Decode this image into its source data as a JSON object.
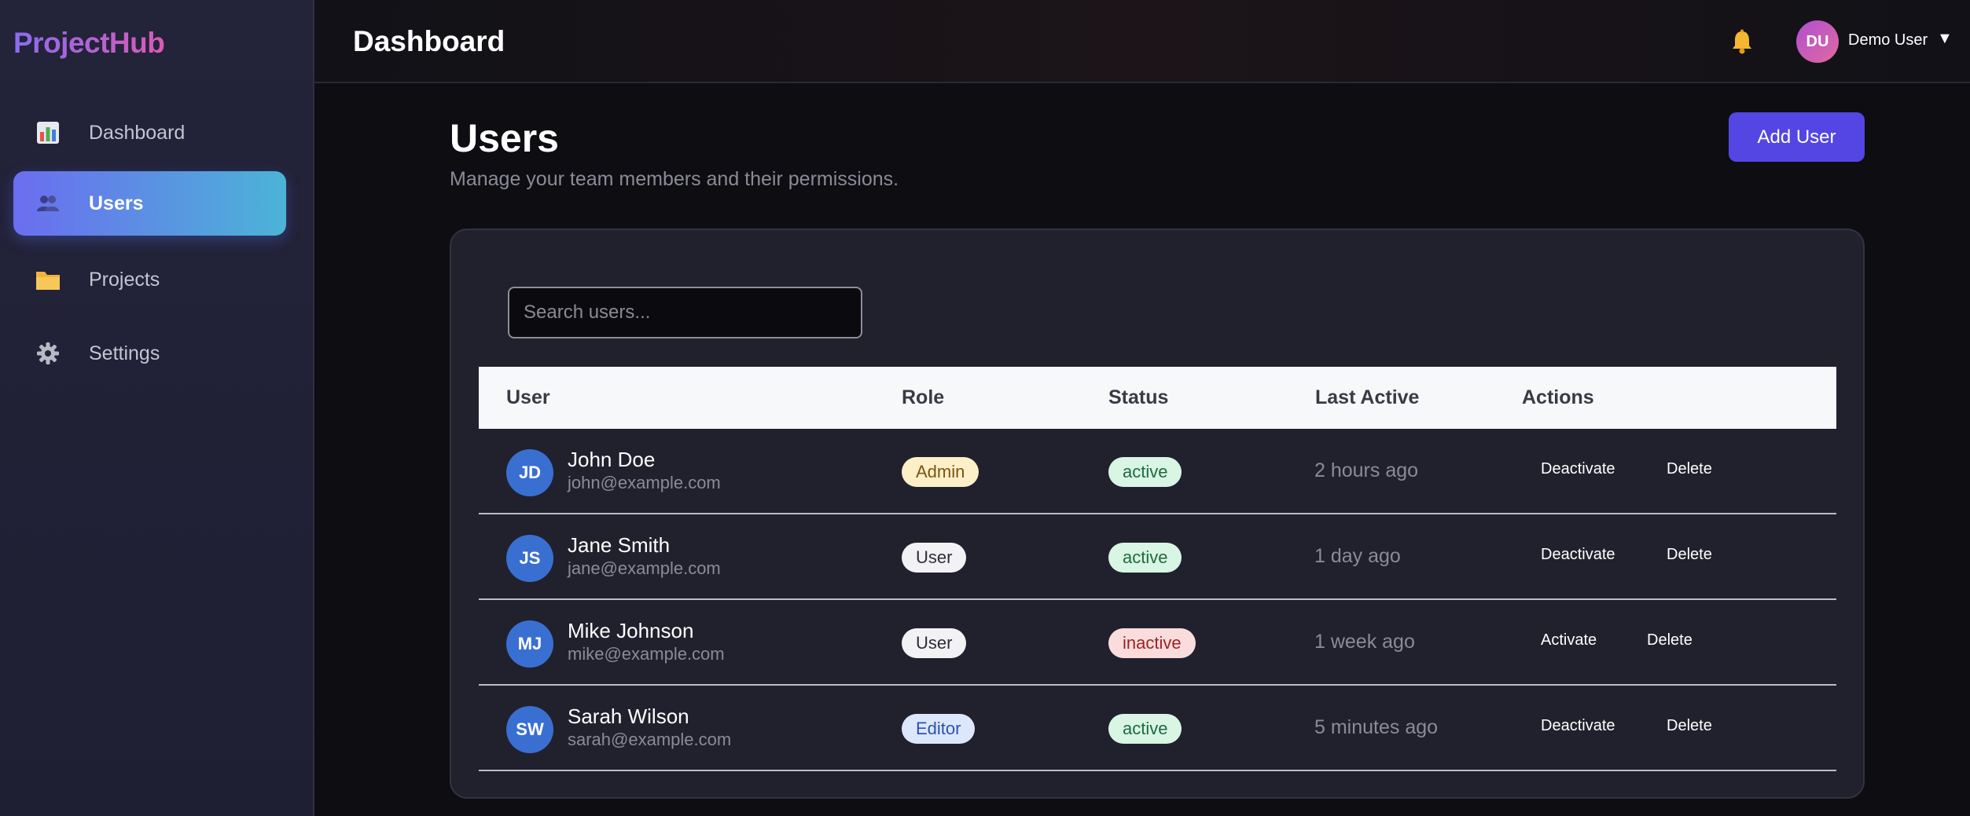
{
  "brand": "ProjectHub",
  "sidebar": {
    "items": [
      {
        "label": "Dashboard",
        "icon": "bar-chart-icon"
      },
      {
        "label": "Users",
        "icon": "users-icon",
        "active": true
      },
      {
        "label": "Projects",
        "icon": "folder-icon"
      },
      {
        "label": "Settings",
        "icon": "gear-icon"
      }
    ]
  },
  "header": {
    "title": "Dashboard",
    "notification_icon": "bell-icon",
    "user_initials": "DU",
    "user_name": "Demo User",
    "caret": "▼"
  },
  "main": {
    "title": "Users",
    "subtitle": "Manage your team members and their permissions.",
    "add_button": "Add User"
  },
  "search": {
    "placeholder": "Search users..."
  },
  "table": {
    "columns": [
      "User",
      "Role",
      "Status",
      "Last Active",
      "Actions"
    ],
    "rows": [
      {
        "initials": "JD",
        "name": "John Doe",
        "email": "john@example.com",
        "role": "Admin",
        "status": "active",
        "last_active": "2 hours ago",
        "toggle_action": "Deactivate",
        "delete_action": "Delete"
      },
      {
        "initials": "JS",
        "name": "Jane Smith",
        "email": "jane@example.com",
        "role": "User",
        "status": "active",
        "last_active": "1 day ago",
        "toggle_action": "Deactivate",
        "delete_action": "Delete"
      },
      {
        "initials": "MJ",
        "name": "Mike Johnson",
        "email": "mike@example.com",
        "role": "User",
        "status": "inactive",
        "last_active": "1 week ago",
        "toggle_action": "Activate",
        "delete_action": "Delete"
      },
      {
        "initials": "SW",
        "name": "Sarah Wilson",
        "email": "sarah@example.com",
        "role": "Editor",
        "status": "active",
        "last_active": "5 minutes ago",
        "toggle_action": "Deactivate",
        "delete_action": "Delete"
      }
    ]
  },
  "colors": {
    "accent": "#5346e3",
    "active_nav_start": "#6b6df0",
    "active_nav_end": "#4bb4d6",
    "avatar": "#3a6fd2"
  }
}
